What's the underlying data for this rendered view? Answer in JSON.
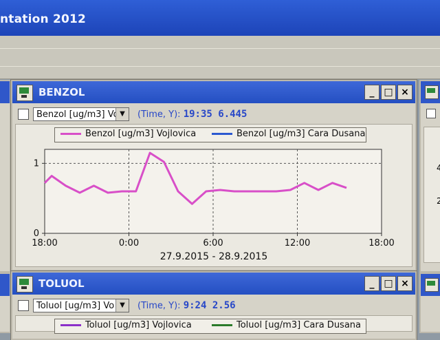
{
  "app": {
    "title": "ntation 2012"
  },
  "benzol_window": {
    "title": "BENZOL",
    "controls": {
      "minimize": "_",
      "maximize": "□",
      "close": "×"
    },
    "select_value": "Benzol [ug/m3] Vo",
    "readout_label": "(Time, Y):",
    "readout_value": "19:35 6.445",
    "legend": [
      {
        "name": "Benzol [ug/m3] Vojlovica",
        "color": "#d84fc8"
      },
      {
        "name": "Benzol [ug/m3] Cara Dusana",
        "color": "#2a58d0"
      }
    ],
    "date_range": "27.9.2015 - 28.9.2015"
  },
  "toluol_window": {
    "title": "TOLUOL",
    "controls": {
      "minimize": "_",
      "maximize": "□",
      "close": "×"
    },
    "select_value": "Toluol [ug/m3] Vo",
    "readout_label": "(Time, Y):",
    "readout_value": "9:24 2.56",
    "legend": [
      {
        "name": "Toluol [ug/m3] Vojlovica",
        "color": "#8b2fc9"
      },
      {
        "name": "Toluol [ug/m3] Cara Dusana",
        "color": "#2a7a2a"
      }
    ]
  },
  "right_partial": {
    "tick_a": "4",
    "tick_b": "2"
  },
  "chart_data": {
    "type": "line",
    "x_tick_labels": [
      "18:00",
      "0:00",
      "6:00",
      "12:00",
      "18:00"
    ],
    "y_tick_labels": [
      "0",
      "1"
    ],
    "ylim": [
      0,
      1.2
    ],
    "x_range_hours": [
      0,
      24
    ],
    "grid": true,
    "series": [
      {
        "name": "Benzol [ug/m3] Vojlovica",
        "color": "#d84fc8",
        "x_hours": [
          0,
          0.5,
          1.5,
          2.5,
          3.5,
          4.5,
          5.5,
          6.5,
          7.5,
          8.5,
          9.5,
          10.5,
          11.5,
          12.5,
          13.5,
          14.5,
          15.5,
          16.5,
          17.5,
          18.5,
          19.5,
          20.5,
          21.5
        ],
        "values": [
          0.72,
          0.82,
          0.68,
          0.58,
          0.68,
          0.58,
          0.6,
          0.6,
          1.15,
          1.02,
          0.6,
          0.42,
          0.6,
          0.62,
          0.6,
          0.6,
          0.6,
          0.6,
          0.62,
          0.72,
          0.62,
          0.72,
          0.65
        ]
      },
      {
        "name": "Benzol [ug/m3] Cara Dusana",
        "color": "#2a58d0",
        "x_hours": [],
        "values": []
      }
    ],
    "xlabel": "27.9.2015 - 28.9.2015"
  }
}
